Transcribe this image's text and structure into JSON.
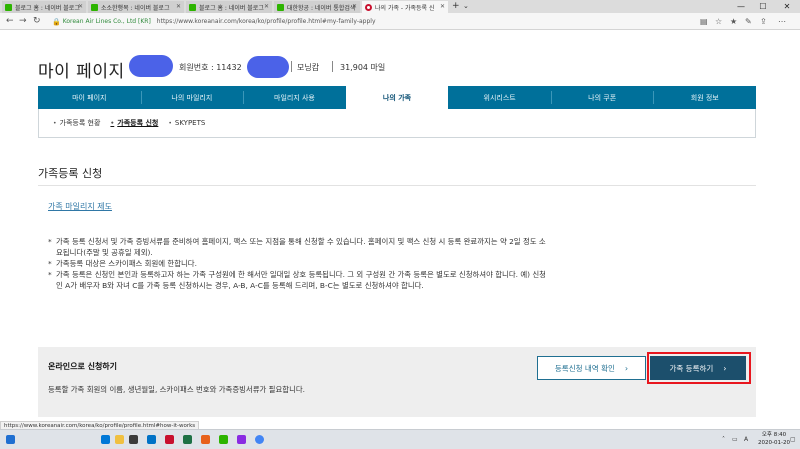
{
  "browser": {
    "tabs": [
      {
        "title": "블로그 홈 : 네이버 블로그",
        "active": false
      },
      {
        "title": "소소한행복 : 네이버 블로그",
        "active": false
      },
      {
        "title": "블로그 홈 : 네이버 블로그",
        "active": false
      },
      {
        "title": "대한항공 : 네이버 통합검색",
        "active": false
      },
      {
        "title": "나의 가족 - 가족등록 신",
        "active": true
      }
    ],
    "new_tab": "+",
    "tab_list": "⌄",
    "site_identity": "Korean Air Lines Co., Ltd [KR]",
    "url": "https://www.koreanair.com/korea/ko/profile/profile.html#my-family-apply",
    "status_url": "https://www.koreanair.com/korea/ko/profile/profile.html#how-it-works"
  },
  "header": {
    "title": "마이 페이지",
    "member_label": "회원번호 : 11432",
    "grade": "모닝캄",
    "miles": "31,904 마일"
  },
  "nav": {
    "items": [
      {
        "label": "마이 페이지",
        "active": false
      },
      {
        "label": "나의 마일리지",
        "active": false
      },
      {
        "label": "마일리지 사용",
        "active": false
      },
      {
        "label": "나의 가족",
        "active": true
      },
      {
        "label": "위시리스트",
        "active": false
      },
      {
        "label": "나의 쿠폰",
        "active": false
      },
      {
        "label": "회원 정보",
        "active": false
      }
    ]
  },
  "subnav": {
    "items": [
      {
        "label": "가족등록 현황",
        "active": false
      },
      {
        "label": "가족등록 신청",
        "active": true
      },
      {
        "label": "SKYPETS",
        "active": false
      }
    ]
  },
  "section": {
    "title": "가족등록 신청",
    "link": "가족 마일리지 제도",
    "notes": [
      "가족 등록 신청서 및 가족 증빙서류를 준비하여 홈페이지, 팩스 또는 지점을 통해 신청할 수 있습니다. 홈페이지 및 팩스 신청 시 등록 완료까지는 약 2일 정도 소요됩니다(주말 및 공휴일 제외).",
      "가족등록 대상은 스카이패스 회원에 한합니다.",
      "가족 등록은 신청인 본인과 등록하고자 하는 가족 구성원에 한 해서만 일대일 상호 등록됩니다. 그 외 구성원 간 가족 등록은 별도로 신청하셔야 합니다. 예) 신청인 A가 배우자 B와 자녀 C를 가족 등록 신청하시는 경우, A-B, A-C를 등록해 드리며, B-C는 별도로 신청하셔야 합니다."
    ],
    "note_marker": "*"
  },
  "online": {
    "title": "온라인으로 신청하기",
    "description": "등록할 가족 회원의 이름, 생년월일, 스카이패스 번호와 가족증빙서류가 필요합니다.",
    "history_button": "등록신청 내역 확인",
    "apply_button": "가족 등록하기",
    "chevron": "›"
  },
  "taskbar": {
    "time": "오후 8:40",
    "date": "2020-01-20",
    "lang": "A"
  },
  "colors": {
    "nav_bg": "#00709a",
    "apply_button": "#1c4f6c",
    "highlight": "#e8161e",
    "redaction": "#4b62e8"
  }
}
